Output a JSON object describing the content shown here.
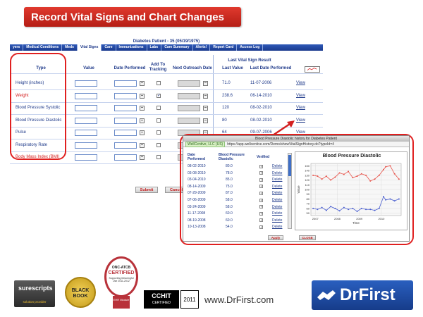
{
  "slide": {
    "banner_title": "Record Vital Signs and Chart Changes",
    "website": "www.DrFirst.com"
  },
  "ehr": {
    "patient_header": "Diabetes  Patient - 35 (05/19/1975)",
    "nav_tabs": [
      {
        "label": "yers",
        "active": false
      },
      {
        "label": "Medical Conditions",
        "active": false
      },
      {
        "label": "Meds",
        "active": false
      },
      {
        "label": "Vital Signs",
        "active": true
      },
      {
        "label": "Care",
        "active": false
      },
      {
        "label": "Immunizations",
        "active": false
      },
      {
        "label": "Labs",
        "active": false
      },
      {
        "label": "Care Summary",
        "active": false
      },
      {
        "label": "Alerts!",
        "active": false
      },
      {
        "label": "Report Card",
        "active": false
      },
      {
        "label": "Access Log",
        "active": false
      }
    ],
    "columns": {
      "type": "Type",
      "value": "Value",
      "date_performed": "Date Performed",
      "add_to_tracking": "Add To Tracking",
      "next_outreach": "Next Outreach Date",
      "last_result_group": "Last Vital Sign Result",
      "last_value": "Last Value",
      "last_date": "Last Date Performed"
    },
    "rows": [
      {
        "type": "Height (inches)",
        "red": false,
        "tracked": false,
        "last_value": "71.0",
        "last_date": "11-07-2006",
        "view": "View"
      },
      {
        "type": "Weight",
        "red": true,
        "tracked": true,
        "last_value": "238.6",
        "last_date": "06-14-2010",
        "view": "View"
      },
      {
        "type": "Blood Pressure Systolic",
        "red": false,
        "tracked": false,
        "last_value": "120",
        "last_date": "08-02-2010",
        "view": "View"
      },
      {
        "type": "Blood Pressure Diastolic",
        "red": false,
        "tracked": false,
        "last_value": "80",
        "last_date": "08-02-2010",
        "view": "View"
      },
      {
        "type": "Pulse",
        "red": false,
        "tracked": false,
        "last_value": "64",
        "last_date": "09-07-2006",
        "view": "View"
      },
      {
        "type": "Respiratory Rate",
        "red": false,
        "tracked": false,
        "last_value": "",
        "last_date": "",
        "view": ""
      },
      {
        "type": "Body Mass Index (BMI)",
        "red": true,
        "tracked": false,
        "last_value": "",
        "last_date": "",
        "view": ""
      }
    ],
    "submit_label": "Submit",
    "cancel_label": "Cancel"
  },
  "popup": {
    "title": "Blood Pressure Diastolic history for Diabetes Patient",
    "site_badge": "WellCentive, LLC (US)",
    "url": "https://app.wellcentive.com/Demo/showVitalSignHistory.do?typeId=4",
    "col_date": "Date Performed",
    "col_value": "Blood Pressure Diastolic",
    "col_verified": "Verified",
    "delete_label": "Delete",
    "history": [
      {
        "date": "08-02-2010",
        "value": "80.0"
      },
      {
        "date": "03-08-2010",
        "value": "78.0"
      },
      {
        "date": "03-04-2010",
        "value": "85.0"
      },
      {
        "date": "08-14-2009",
        "value": "75.0"
      },
      {
        "date": "07-29-2009",
        "value": "87.0"
      },
      {
        "date": "07-06-2009",
        "value": "58.0"
      },
      {
        "date": "03-24-2009",
        "value": "58.0"
      },
      {
        "date": "11-17-2008",
        "value": "60.0"
      },
      {
        "date": "08-19-2008",
        "value": "60.0"
      },
      {
        "date": "10-13-2008",
        "value": "54.0"
      }
    ],
    "apply_label": "Apply",
    "close_label": "CLOSE"
  },
  "chart_data": {
    "type": "line",
    "title": "Blood Pressure Diastolic",
    "xlabel": "Time",
    "ylabel": "Value",
    "xticks": [
      "2007",
      "2008",
      "2009",
      "2010"
    ],
    "yticks": [
      50,
      60,
      70,
      80,
      90,
      100,
      110,
      120,
      130,
      140,
      150
    ],
    "ylim": [
      45,
      155
    ],
    "xlim": [
      2006.8,
      2010.9
    ],
    "grid": true,
    "series": [
      {
        "name": "",
        "color": "#e8544b",
        "x": [
          2006.9,
          2007.1,
          2007.3,
          2007.5,
          2007.7,
          2007.9,
          2008.1,
          2008.3,
          2008.5,
          2008.7,
          2008.9,
          2009.1,
          2009.3,
          2009.5,
          2009.7,
          2009.9,
          2010.1,
          2010.2,
          2010.4,
          2010.6,
          2010.8
        ],
        "y": [
          130,
          128,
          122,
          128,
          120,
          126,
          135,
          132,
          138,
          125,
          128,
          133,
          130,
          118,
          122,
          130,
          142,
          148,
          150,
          133,
          122
        ]
      },
      {
        "name": "",
        "color": "#4a5fd0",
        "x": [
          2006.9,
          2007.1,
          2007.3,
          2007.5,
          2007.7,
          2007.9,
          2008.1,
          2008.3,
          2008.5,
          2008.7,
          2008.9,
          2009.1,
          2009.3,
          2009.5,
          2009.7,
          2009.9,
          2010.1,
          2010.2,
          2010.4,
          2010.6,
          2010.8
        ],
        "y": [
          60,
          58,
          62,
          56,
          64,
          60,
          55,
          62,
          58,
          60,
          54,
          60,
          58,
          58,
          56,
          60,
          85,
          78,
          80,
          76,
          80
        ]
      }
    ]
  },
  "logos": {
    "surescripts": "surescripts",
    "surescripts_tag": "solution provider",
    "blackbook": "BLACK BOOK",
    "onc_line1": "ONC-ATCB",
    "onc_line2": "CERTIFIED",
    "onc_line3": "Supporting Meaningful Use 2011-2012",
    "onc_ribbon": "EHR Module",
    "cchit_line1": "CCHIT",
    "cchit_line2": "CERTIFIED",
    "cchit_year": "2011",
    "drfirst": "DrFirst"
  },
  "colors": {
    "banner_red": "#c8261b",
    "ehr_blue": "#1f3a8a",
    "highlight_red": "#e02020",
    "drfirst_blue": "#1d4aa5"
  }
}
